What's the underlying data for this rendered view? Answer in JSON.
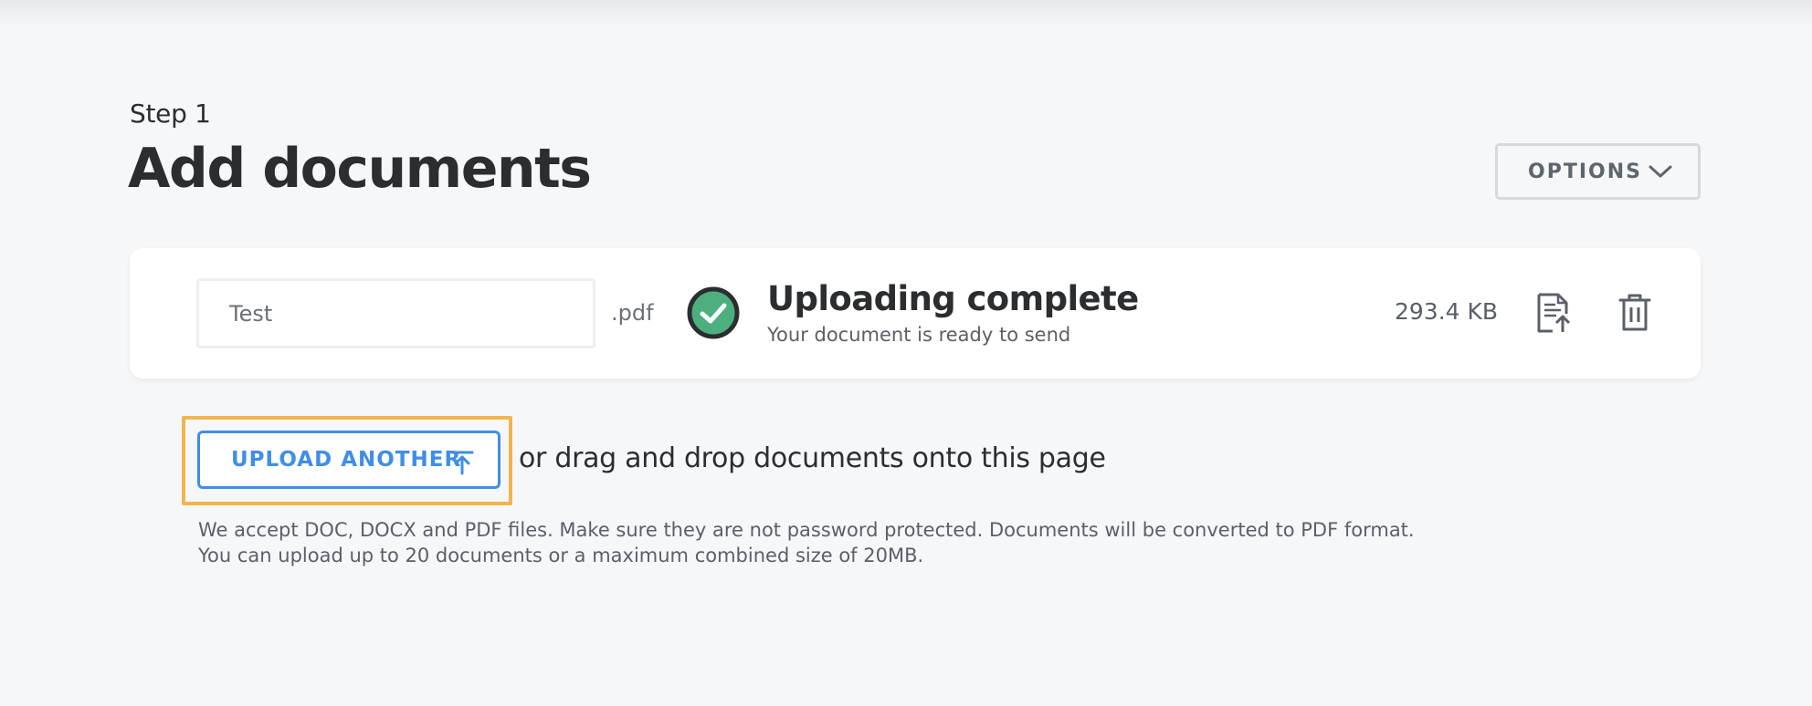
{
  "header": {
    "step_label": "Step 1",
    "title": "Add documents",
    "options_label": "OPTIONS",
    "options_icon": "chevron-down-icon"
  },
  "document": {
    "name_value": "Test",
    "extension": ".pdf",
    "status_icon": "check-circle-icon",
    "status_color": "#4caf7d",
    "status_title": "Uploading complete",
    "status_subtitle": "Your document is ready to send",
    "file_size": "293.4 KB",
    "actions": [
      "document-upload-icon",
      "trash-icon"
    ]
  },
  "upload": {
    "button_label": "UPLOAD ANOTHER",
    "button_icon": "arrow-up-icon",
    "accent_color": "#3f8ee8",
    "drag_text": "or drag and drop documents onto this page",
    "help_line_1": "We accept DOC, DOCX and PDF files. Make sure they are not password protected. Documents will be converted to PDF format.",
    "help_line_2": "You can upload up to 20 documents or a maximum combined size of 20MB."
  }
}
